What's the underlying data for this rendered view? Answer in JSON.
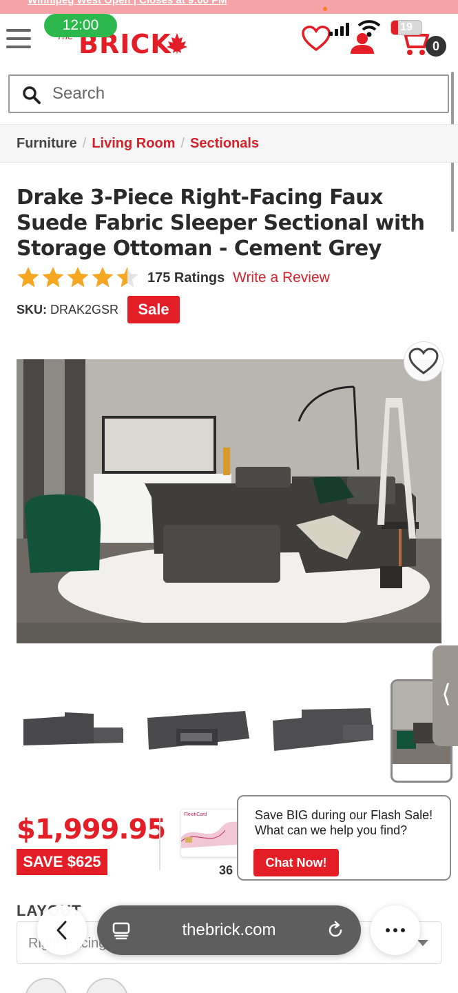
{
  "top_banner": {
    "text": "Winnipeg West  Open | Closes at 9:00 PM"
  },
  "status_bar": {
    "time": "12:00",
    "battery": "19"
  },
  "header": {
    "logo_the": "The",
    "logo_text": "BRICK",
    "cart_count": "0"
  },
  "search": {
    "placeholder": "Search"
  },
  "breadcrumb": {
    "items": [
      "Furniture",
      "Living Room",
      "Sectionals"
    ]
  },
  "product": {
    "title": "Drake 3-Piece Right-Facing Faux Suede Fabric Sleeper Sectional with Storage Ottoman - Cement Grey",
    "rating": 4.5,
    "ratings_text": "175 Ratings",
    "write_review": "Write a Review",
    "sku_label": "SKU:",
    "sku_value": "DRAK2GSR",
    "sale_badge": "Sale",
    "price": "$1,999.95",
    "save_text": "SAVE $625",
    "months_text": "36",
    "flexiti_brand": "FlexitiCard"
  },
  "chat": {
    "message": "Save BIG during our Flash Sale! What can we help you find?",
    "button": "Chat Now!"
  },
  "layout": {
    "label": "LAYOUT",
    "selected": "Right-Facing"
  },
  "browser": {
    "url": "thebrick.com"
  },
  "colors": {
    "brand_red": "#e41e26",
    "link_red": "#d4212a"
  }
}
